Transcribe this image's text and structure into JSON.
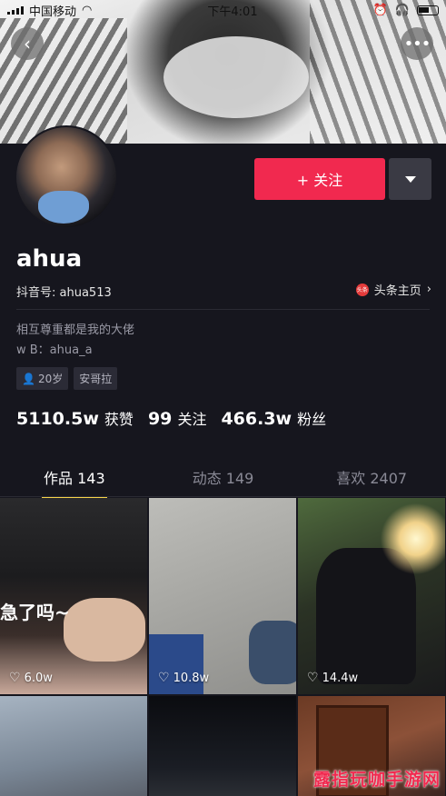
{
  "status_bar": {
    "carrier": "中国移动",
    "time": "下午4:01"
  },
  "profile": {
    "follow_label": "+ 关注",
    "username": "ahua",
    "douyin_id": "抖音号: ahua513",
    "toutiao_label": "头条主页",
    "toutiao_icon_text": "头条",
    "bio_line1": "相互尊重都是我的大佬",
    "bio_line2": "w B：ahua_a",
    "tags": [
      "20岁",
      "安哥拉"
    ],
    "stats": [
      {
        "num": "5110.5w",
        "label": "获赞"
      },
      {
        "num": "99",
        "label": "关注"
      },
      {
        "num": "466.3w",
        "label": "粉丝"
      }
    ]
  },
  "tabs": [
    {
      "label": "作品 143",
      "active": true
    },
    {
      "label": "动态 149",
      "active": false
    },
    {
      "label": "喜欢 2407",
      "active": false
    }
  ],
  "videos": [
    {
      "likes": "6.0w",
      "caption": "急了吗~"
    },
    {
      "likes": "10.8w"
    },
    {
      "likes": "14.4w"
    },
    {},
    {},
    {}
  ],
  "watermark": "露指玩咖手游网",
  "colors": {
    "accent": "#f1294f",
    "tab_indicator": "#f7d54a",
    "background": "#16161e"
  }
}
